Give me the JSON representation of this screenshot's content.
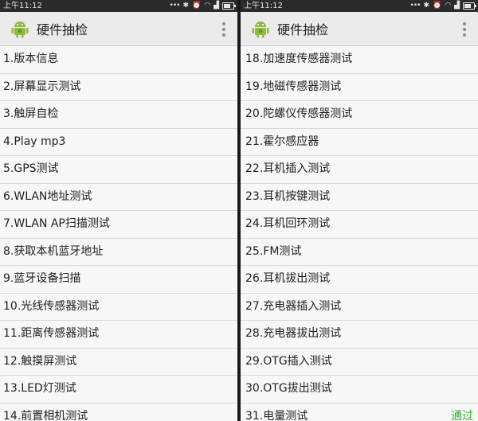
{
  "status_bar": {
    "time": "上午11:12"
  },
  "app_bar": {
    "title": "硬件抽检"
  },
  "left_items": [
    "1.版本信息",
    "2.屏幕显示测试",
    "3.触屏自检",
    "4.Play mp3",
    "5.GPS测试",
    "6.WLAN地址测试",
    "7.WLAN AP扫描测试",
    "8.获取本机蓝牙地址",
    "9.蓝牙设备扫描",
    "10.光线传感器测试",
    "11.距离传感器测试",
    "12.触摸屏测试",
    "13.LED灯测试",
    "14.前置相机测试"
  ],
  "right_items": [
    "18.加速度传感器测试",
    "19.地磁传感器测试",
    "20.陀螺仪传感器测试",
    "21.霍尔感应器",
    "22.耳机插入测试",
    "23.耳机按键测试",
    "24.耳机回环测试",
    "25.FM测试",
    "26.耳机拔出测试",
    "27.充电器插入测试",
    "28.充电器拔出测试",
    "29.OTG插入测试",
    "30.OTG拔出测试",
    "31.电量测试"
  ],
  "pass_label": "通过",
  "colors": {
    "pass": "#2bb32b",
    "android_green": "#8dbb3b"
  }
}
